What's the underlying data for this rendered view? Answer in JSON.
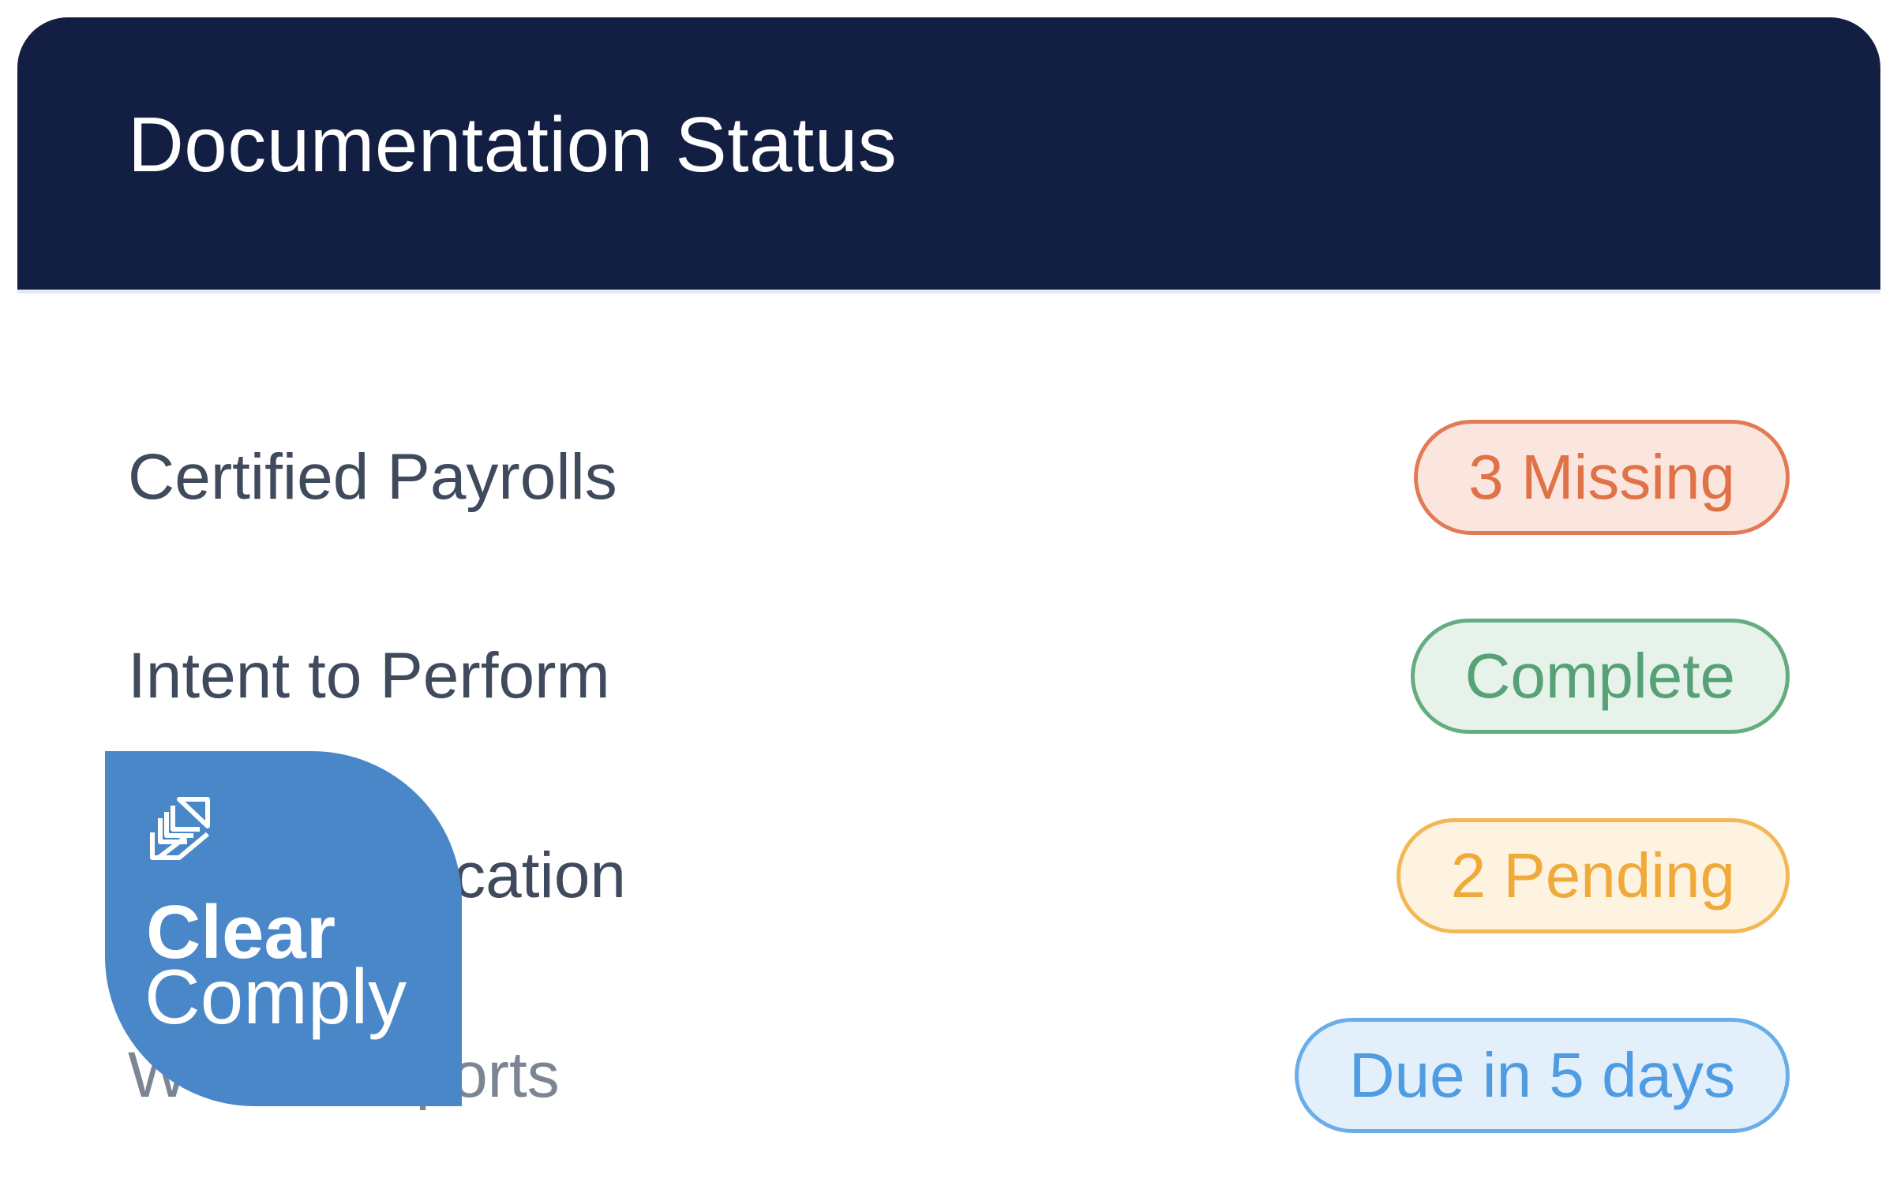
{
  "header": {
    "title": "Documentation Status"
  },
  "rows": [
    {
      "label": "Certified Payrolls",
      "status": "3 Missing",
      "status_kind": "missing"
    },
    {
      "label": "Intent to Perform",
      "status": "Complete",
      "status_kind": "complete"
    },
    {
      "label": "erification",
      "status": "2 Pending",
      "status_kind": "pending"
    },
    {
      "label": "W        Reports",
      "status": "Due in 5 days",
      "status_kind": "due"
    }
  ],
  "logo": {
    "line1": "Clear",
    "line2": "Comply",
    "icon": "leaf-grid-icon"
  },
  "colors": {
    "header_bg": "#131f42",
    "missing": "#e07247",
    "complete": "#56a276",
    "pending": "#efaa3a",
    "due": "#4f9ce2",
    "logo_bg": "#4a87c9"
  }
}
